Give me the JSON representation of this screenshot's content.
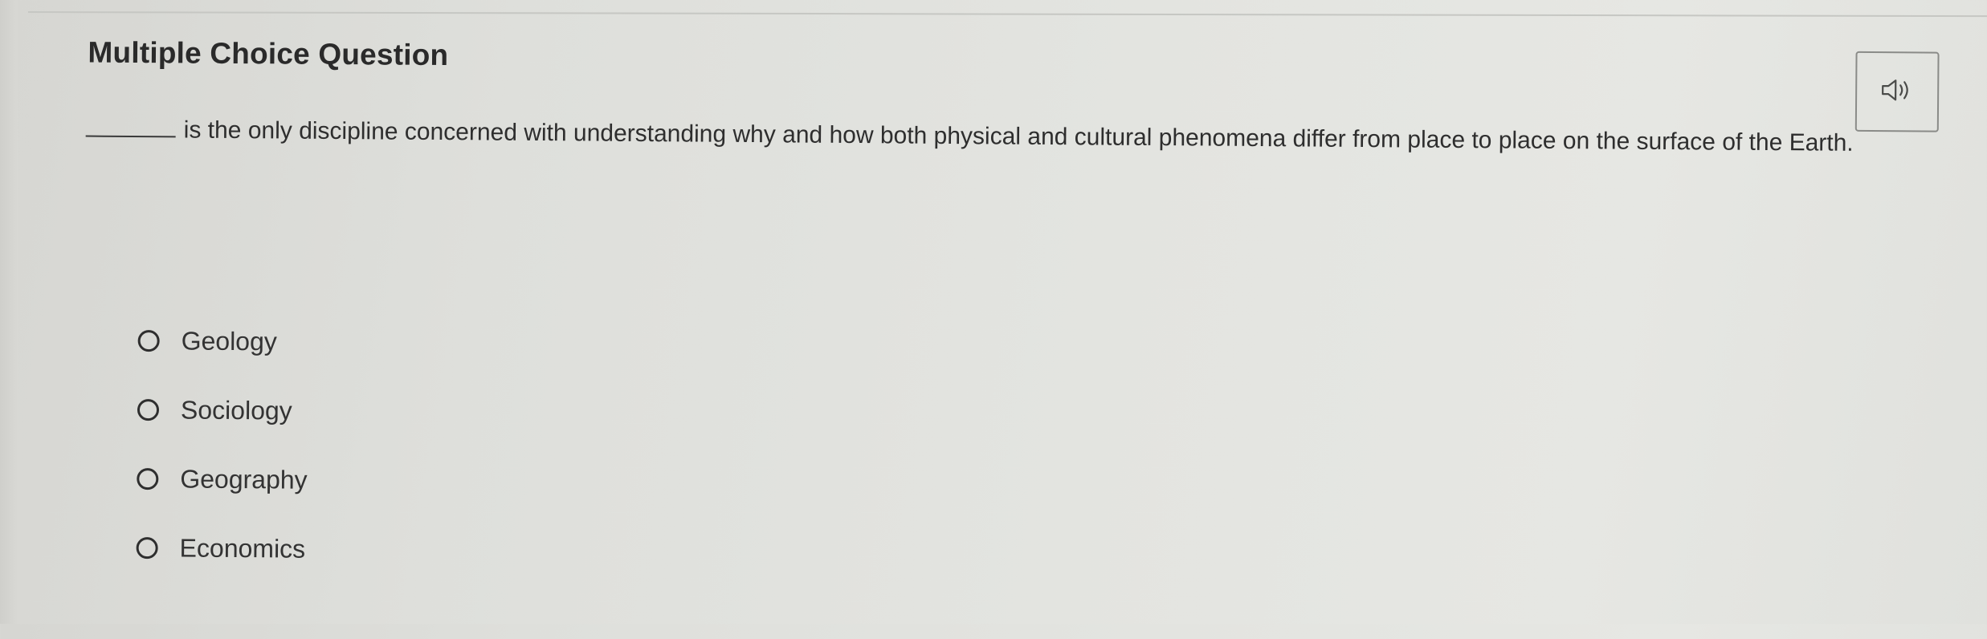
{
  "question": {
    "heading": "Multiple Choice Question",
    "audio_icon": "speaker-icon",
    "blank": "_______",
    "prompt_text": "is the only discipline concerned with understanding why and how both physical and cultural phenomena differ from place to place on the surface of the Earth."
  },
  "options": [
    {
      "label": "Geology"
    },
    {
      "label": "Sociology"
    },
    {
      "label": "Geography"
    },
    {
      "label": "Economics"
    }
  ]
}
